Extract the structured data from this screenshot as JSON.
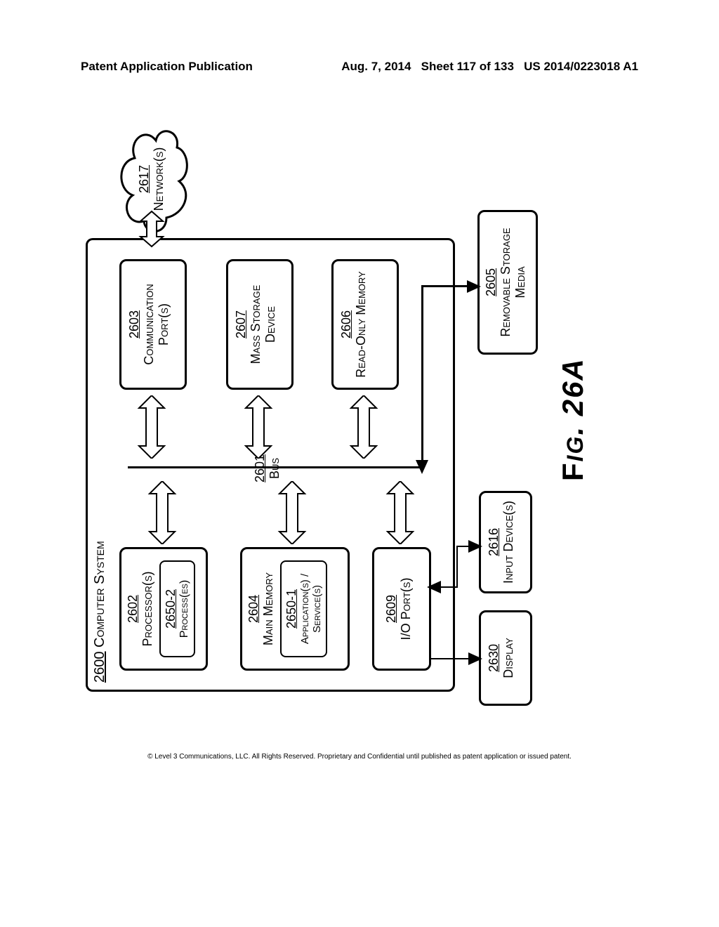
{
  "header": {
    "left": "Patent Application Publication",
    "date": "Aug. 7, 2014",
    "sheet": "Sheet 117 of 133",
    "pubnum": "US 2014/0223018 A1"
  },
  "figure": {
    "caption": "Fig. 26A"
  },
  "system": {
    "ref": "2600",
    "label": "Computer System"
  },
  "bus": {
    "ref": "2601",
    "label": "Bus"
  },
  "processor": {
    "ref": "2602",
    "label": "Processor(s)",
    "inner_ref": "2650-2",
    "inner_label": "Process(es)"
  },
  "main_memory": {
    "ref": "2604",
    "label": "Main Memory",
    "inner_ref": "2650-1",
    "inner_label": "Application(s) / Service(s)"
  },
  "io_port": {
    "ref": "2609",
    "label": "I/O Port(s)"
  },
  "comm_port": {
    "ref": "2603",
    "label": "Communication Port(s)"
  },
  "mass_storage": {
    "ref": "2607",
    "label": "Mass Storage Device"
  },
  "rom": {
    "ref": "2606",
    "label": "Read-Only Memory"
  },
  "network": {
    "ref": "2617",
    "label": "Network(s)"
  },
  "display": {
    "ref": "2630",
    "label": "Display"
  },
  "input_device": {
    "ref": "2616",
    "label": "Input Device(s)"
  },
  "removable": {
    "ref": "2605",
    "label": "Removable Storage Media"
  },
  "footer": "© Level 3 Communications, LLC.  All Rights Reserved.  Proprietary and Confidential until published as patent application or issued patent."
}
